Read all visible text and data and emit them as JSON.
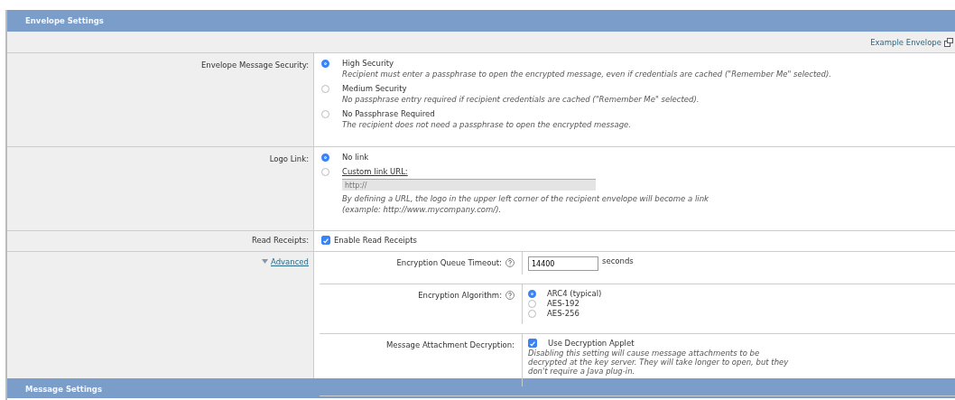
{
  "section_header": {
    "title": "Envelope Settings"
  },
  "example_link": {
    "label": "Example Envelope"
  },
  "security": {
    "label": "Envelope Message Security:",
    "options": [
      {
        "label": "High Security",
        "description": "Recipient must enter a passphrase to open the encrypted message, even if credentials are cached (\"Remember Me\" selected).",
        "selected": true
      },
      {
        "label": "Medium Security",
        "description": "No passphrase entry required if recipient credentials are cached (\"Remember Me\" selected).",
        "selected": false
      },
      {
        "label": "No Passphrase Required",
        "description": "The recipient does not need a passphrase to open the encrypted message.",
        "selected": false
      }
    ]
  },
  "logo_link": {
    "label": "Logo Link:",
    "options": [
      {
        "label": "No link",
        "selected": true
      },
      {
        "label": "Custom link URL:",
        "selected": false
      }
    ],
    "url_placeholder": "http://",
    "note": "By defining a URL, the logo in the upper left corner of the recipient envelope will become a link (example: http://www.mycompany.com/)."
  },
  "read_receipts": {
    "label": "Read Receipts:",
    "option": "Enable Read Receipts",
    "checked": true
  },
  "advanced": {
    "label": "Advanced",
    "expanded": true,
    "timeout": {
      "label": "Encryption Queue Timeout:",
      "value": "14400",
      "unit": "seconds"
    },
    "algorithm": {
      "label": "Encryption Algorithm:",
      "options": [
        {
          "label": "ARC4 (typical)",
          "selected": true
        },
        {
          "label": "AES-192",
          "selected": false
        },
        {
          "label": "AES-256",
          "selected": false
        }
      ]
    },
    "attachment": {
      "label": "Message Attachment Decryption:",
      "option": "Use Decryption Applet",
      "checked": true,
      "note": "Disabling this setting will cause message attachments to be decrypted at the key server. They will take longer to open, but they don't require a Java plug-in."
    }
  },
  "next_section_header": {
    "title": "Message Settings"
  }
}
